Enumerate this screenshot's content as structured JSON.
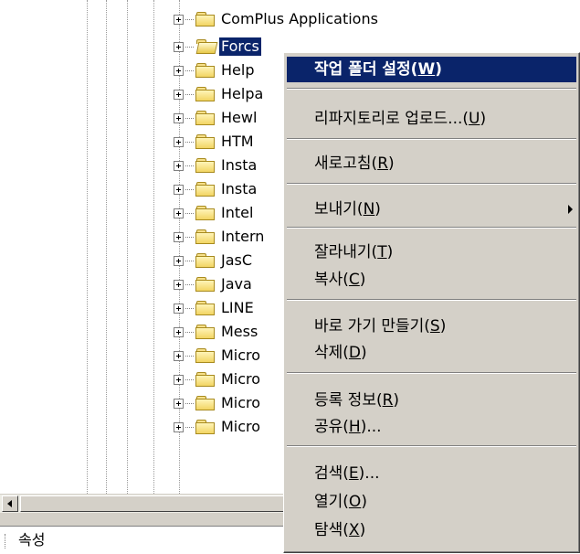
{
  "tree": {
    "items": [
      {
        "label": "ComPlus Applications",
        "selected": false
      },
      {
        "label": "Forcs",
        "selected": true
      },
      {
        "label": "Help",
        "selected": false
      },
      {
        "label": "Helpa",
        "selected": false
      },
      {
        "label": "Hewl",
        "selected": false
      },
      {
        "label": "HTM",
        "selected": false
      },
      {
        "label": "Insta",
        "selected": false
      },
      {
        "label": "Insta",
        "selected": false
      },
      {
        "label": "Intel",
        "selected": false
      },
      {
        "label": "Intern",
        "selected": false
      },
      {
        "label": "JasC",
        "selected": false
      },
      {
        "label": "Java",
        "selected": false
      },
      {
        "label": "LINE",
        "selected": false
      },
      {
        "label": "Mess",
        "selected": false
      },
      {
        "label": "Micro",
        "selected": false
      },
      {
        "label": "Micro",
        "selected": false
      },
      {
        "label": "Micro",
        "selected": false
      },
      {
        "label": "Micro",
        "selected": false
      }
    ]
  },
  "bottom_pane": {
    "title": "속성"
  },
  "context_menu": {
    "items": [
      {
        "label": "작업 폴더 설정(",
        "key": "W",
        "suffix": ")",
        "highlight": true
      },
      {
        "label": "리파지토리로 업로드...(",
        "key": "U",
        "suffix": ")"
      },
      {
        "label": "새로고침(",
        "key": "R",
        "suffix": ")"
      },
      {
        "label": "보내기(",
        "key": "N",
        "suffix": ")",
        "submenu": true
      },
      {
        "label": "잘라내기(",
        "key": "T",
        "suffix": ")"
      },
      {
        "label": "복사(",
        "key": "C",
        "suffix": ")"
      },
      {
        "label": "바로 가기 만들기(",
        "key": "S",
        "suffix": ")"
      },
      {
        "label": "삭제(",
        "key": "D",
        "suffix": ")"
      },
      {
        "label": "등록 정보(",
        "key": "R",
        "suffix": ")"
      },
      {
        "label": "공유(",
        "key": "H",
        "suffix": ")..."
      },
      {
        "label": "검색(",
        "key": "E",
        "suffix": ")..."
      },
      {
        "label": "열기(",
        "key": "O",
        "suffix": ")"
      },
      {
        "label": "탐색(",
        "key": "X",
        "suffix": ")"
      }
    ]
  },
  "colors": {
    "selection": "#0a246a",
    "menu_bg": "#d4d0c8",
    "folder": "#f2d563"
  }
}
